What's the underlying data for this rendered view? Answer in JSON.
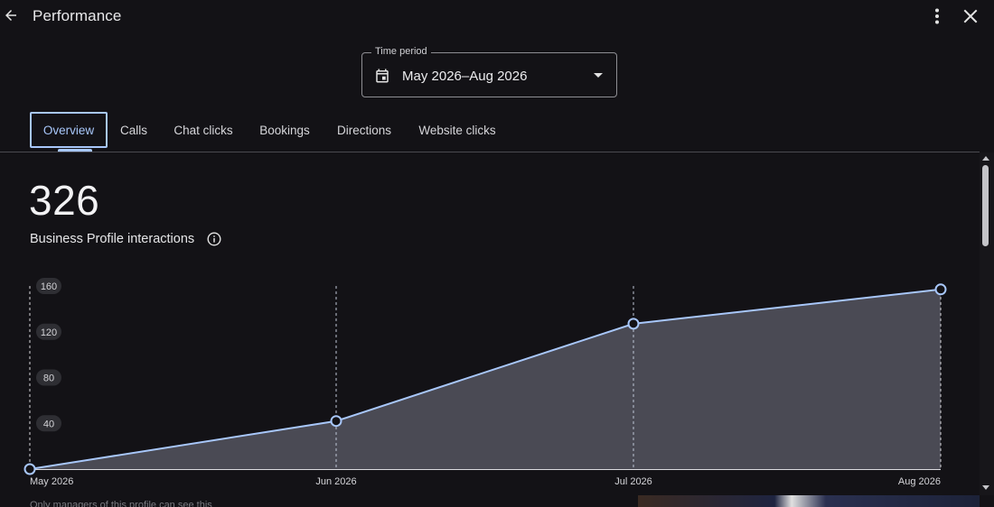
{
  "header": {
    "title": "Performance"
  },
  "time_period": {
    "legend": "Time period",
    "value": "May 2026–Aug 2026"
  },
  "tabs": [
    {
      "label": "Overview",
      "active": true
    },
    {
      "label": "Calls"
    },
    {
      "label": "Chat clicks"
    },
    {
      "label": "Bookings"
    },
    {
      "label": "Directions"
    },
    {
      "label": "Website clicks"
    }
  ],
  "summary": {
    "total": "326",
    "label": "Business Profile interactions"
  },
  "footer": {
    "note": "Only managers of this profile can see this"
  },
  "colors": {
    "accent": "#a8c7fa",
    "area_fill": "#4a4a54",
    "background": "#131216"
  },
  "chart_data": {
    "type": "area",
    "categories": [
      "May 2026",
      "Jun 2026",
      "Jul 2026",
      "Aug 2026"
    ],
    "values": [
      0,
      42,
      127,
      157
    ],
    "yticks": [
      40,
      80,
      120,
      160
    ],
    "ylim": [
      0,
      160
    ],
    "grid": "vertical dashed at each category"
  }
}
